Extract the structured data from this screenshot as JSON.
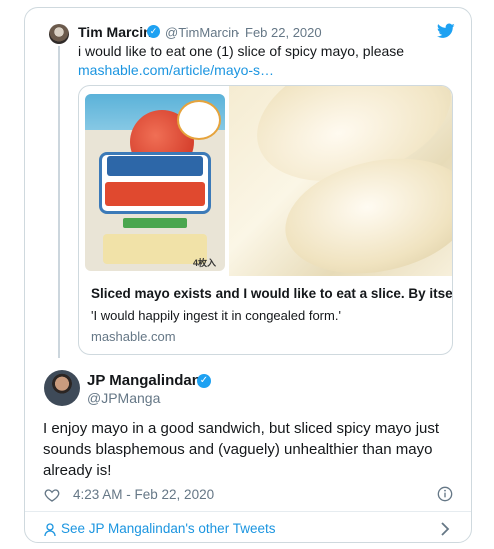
{
  "quoted_tweet": {
    "name": "Tim Marcin",
    "handle": "@TimMarcin",
    "separator": "·",
    "date": "Feb 22, 2020",
    "text": "i would like to eat one (1) slice of spicy mayo, please",
    "link_text": "mashable.com/article/mayo-s…"
  },
  "link_card": {
    "title": "Sliced mayo exists and I would like to eat a slice. By itself.",
    "description": "'I would happily ingest it in congealed form.'",
    "domain": "mashable.com",
    "package_count": "4枚入"
  },
  "tweet": {
    "author_name": "JP Mangalindan",
    "author_handle": "@JPManga",
    "text": "I enjoy mayo in a good sandwich, but sliced spicy mayo just sounds blasphemous and (vaguely) unhealthier than mayo already is!",
    "timestamp": "4:23 AM - Feb 22, 2020"
  },
  "footer": {
    "link_text": "See JP Mangalindan's other Tweets"
  },
  "icons": [
    "twitter-bird-icon",
    "verified-icon",
    "heart-icon",
    "info-icon",
    "profile-icon",
    "chevron-right-icon"
  ],
  "colors": {
    "accent": "#1b95e0",
    "verified": "#1da1f2",
    "muted": "#657786",
    "text": "#14171a"
  }
}
